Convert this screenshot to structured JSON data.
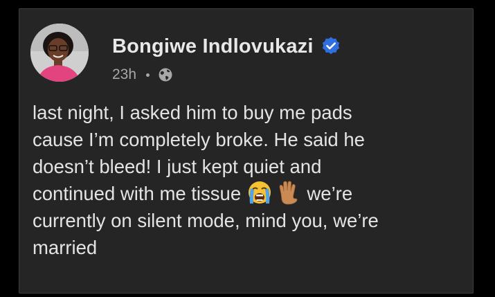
{
  "post": {
    "author": {
      "name": "Bongiwe Indlovukazi",
      "verified_icon": "verified-badge-icon",
      "avatar_icon": "avatar"
    },
    "meta": {
      "time": "23h",
      "separator": "•",
      "audience_icon": "globe-icon"
    },
    "text_before_emoji": "last night, I asked him to buy me pads\ncause I’m completely broke. He said he\ndoesn’t bleed! I just kept quiet and\ncontinued with me tissue ",
    "emojis": [
      "loudly-crying-face-emoji",
      "raised-hand-emoji"
    ],
    "text_after_emoji": "  we’re\ncurrently on silent mode, mind you, we’re\nmarried"
  },
  "colors": {
    "background": "#000000",
    "card": "#252526",
    "text": "#e4e4e4",
    "meta": "#a8a8a8",
    "verified": "#2f6fe0"
  }
}
